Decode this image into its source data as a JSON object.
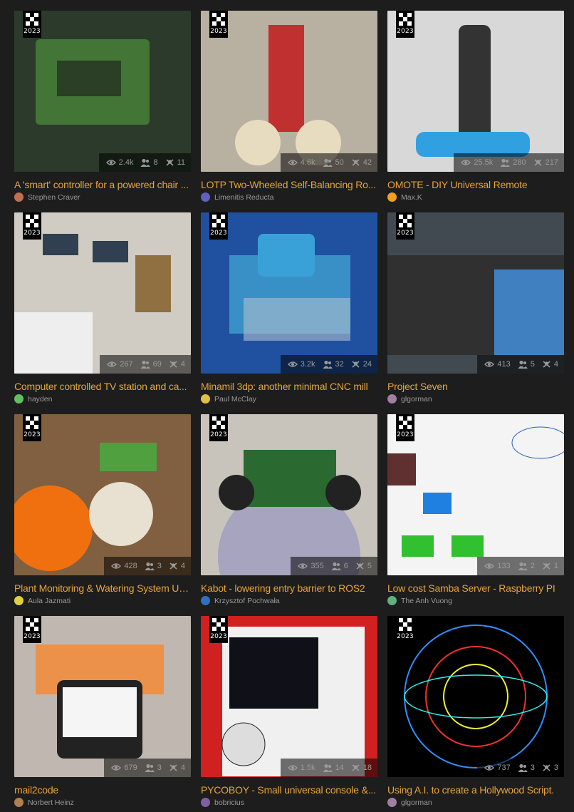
{
  "badge_year": "2023",
  "cards": [
    {
      "title": "A 'smart' controller for a powered chair ...",
      "author": "Stephen Craver",
      "views": "2.4k",
      "likes": "8",
      "followers": "11",
      "bg": "#2c3a2c",
      "accent": "#4a8a3a",
      "avatar": "#c07050"
    },
    {
      "title": "LOTP Two-Wheeled Self-Balancing Ro...",
      "author": "Limenitis Reducta",
      "views": "4.6k",
      "likes": "50",
      "followers": "42",
      "bg": "#b8b0a0",
      "accent": "#c03030",
      "avatar": "#6060c0"
    },
    {
      "title": "OMOTE - DIY Universal Remote",
      "author": "Max.K",
      "views": "25.5k",
      "likes": "280",
      "followers": "217",
      "bg": "#d8d8d8",
      "accent": "#30a0e0",
      "avatar": "#f0a020"
    },
    {
      "title": "Computer controlled TV station and ca...",
      "author": "hayden",
      "views": "267",
      "likes": "69",
      "followers": "4",
      "bg": "#d0ccc4",
      "accent": "#304050",
      "avatar": "#60c060"
    },
    {
      "title": "Minamil 3dp: another minimal CNC mill",
      "author": "Paul McClay",
      "views": "3.2k",
      "likes": "32",
      "followers": "24",
      "bg": "#2050a0",
      "accent": "#40a0d0",
      "avatar": "#e0c040"
    },
    {
      "title": "Project Seven",
      "author": "glgorman",
      "views": "413",
      "likes": "5",
      "followers": "4",
      "bg": "#404a50",
      "accent": "#4080c0",
      "avatar": "#a080a0"
    },
    {
      "title": "Plant Monitoring & Watering System Us...",
      "author": "Aula Jazmati",
      "views": "428",
      "likes": "3",
      "followers": "4",
      "bg": "#806040",
      "accent": "#f07010",
      "avatar": "#e0d040"
    },
    {
      "title": "Kabot - lowering entry barrier to ROS2",
      "author": "Krzysztof Pochwała",
      "views": "355",
      "likes": "6",
      "followers": "5",
      "bg": "#c8c4bc",
      "accent": "#2a6a30",
      "avatar": "#3070c0"
    },
    {
      "title": "Low cost Samba Server - Raspberry PI",
      "author": "The Anh Vuong",
      "views": "133",
      "likes": "2",
      "followers": "1",
      "bg": "#f4f4f4",
      "accent": "#30c030",
      "avatar": "#60b080"
    },
    {
      "title": "mail2code",
      "author": "Norbert Heinz",
      "views": "679",
      "likes": "3",
      "followers": "4",
      "bg": "#c0b8b0",
      "accent": "#e0b030",
      "avatar": "#b08050"
    },
    {
      "title": "PYCOBOY - Small universal console &...",
      "author": "bobricius",
      "views": "1.5k",
      "likes": "14",
      "followers": "18",
      "bg": "#d02020",
      "accent": "#f0f0f0",
      "avatar": "#8060a0"
    },
    {
      "title": "Using A.I. to create a Hollywood Script.",
      "author": "glgorman",
      "views": "737",
      "likes": "3",
      "followers": "3",
      "bg": "#000000",
      "accent": "#3090ff",
      "avatar": "#a080a0"
    }
  ],
  "colors": {
    "background": "#1d1d1d",
    "title": "#e8a33a",
    "meta": "#9a9a9a"
  },
  "icons": {
    "views": "eye-icon",
    "likes": "users-icon",
    "followers": "crossbones-icon"
  }
}
